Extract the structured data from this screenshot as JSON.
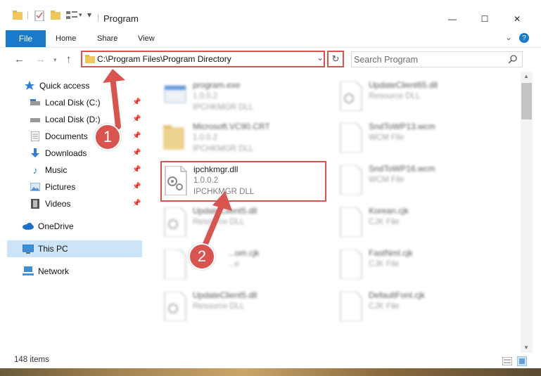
{
  "window": {
    "title": "Program",
    "minimize_label": "—",
    "maximize_label": "☐",
    "close_label": "✕"
  },
  "ribbon": {
    "tabs": [
      {
        "label": "File"
      },
      {
        "label": "Home"
      },
      {
        "label": "Share"
      },
      {
        "label": "View"
      }
    ],
    "help_label": "?"
  },
  "address": {
    "path": "C:\\Program Files\\Program Directory",
    "dropdown_glyph": "⌄",
    "refresh_glyph": "↻"
  },
  "search": {
    "placeholder": "Search Program"
  },
  "sidebar": {
    "items": [
      {
        "label": "Quick access",
        "icon": "star-icon"
      },
      {
        "label": "Local Disk (C:)",
        "icon": "drive-icon",
        "pinned": true
      },
      {
        "label": "Local Disk (D:)",
        "icon": "drive-icon",
        "pinned": true
      },
      {
        "label": "Documents",
        "icon": "documents-icon",
        "pinned": true
      },
      {
        "label": "Downloads",
        "icon": "download-icon",
        "pinned": true
      },
      {
        "label": "Music",
        "icon": "music-icon",
        "pinned": true
      },
      {
        "label": "Pictures",
        "icon": "pictures-icon",
        "pinned": true
      },
      {
        "label": "Videos",
        "icon": "videos-icon",
        "pinned": true
      },
      {
        "label": "OneDrive",
        "icon": "cloud-icon"
      },
      {
        "label": "This PC",
        "icon": "computer-icon",
        "selected": true
      },
      {
        "label": "Network",
        "icon": "network-icon"
      }
    ]
  },
  "files": {
    "left": [
      {
        "name": "program.exe",
        "line2": "1.0.0.2",
        "line3": "IPCHKMGR DLL",
        "icon": "exe-icon"
      },
      {
        "name": "Microsoft.VC90.CRT",
        "line2": "1.0.0.2",
        "line3": "IPCHKMGR DLL",
        "icon": "folder-icon"
      },
      {
        "name": "ipchkmgr.dll",
        "line2": "1.0.0.2",
        "line3": "IPCHKMGR DLL",
        "icon": "dll-icon"
      },
      {
        "name": "UpdateClient5.dll",
        "line2": "Resource DLL",
        "line3": "",
        "icon": "dll-icon"
      },
      {
        "name": "...om.cjk",
        "line2": "...e",
        "line3": "",
        "icon": "file-icon"
      },
      {
        "name": "UpdateClient5.dll",
        "line2": "Resource DLL",
        "line3": "",
        "icon": "dll-icon"
      }
    ],
    "right": [
      {
        "name": "UpdateClient65.dll",
        "line2": "Resource DLL",
        "line3": "",
        "icon": "dll-icon"
      },
      {
        "name": "SndToWP13.wcm",
        "line2": "WCM File",
        "line3": "",
        "icon": "file-icon"
      },
      {
        "name": "SndToWP16.wcm",
        "line2": "WCM File",
        "line3": "",
        "icon": "file-icon"
      },
      {
        "name": "Korean.cjk",
        "line2": "CJK File",
        "line3": "",
        "icon": "file-icon"
      },
      {
        "name": "FastNml.cjk",
        "line2": "CJK File",
        "line3": "",
        "icon": "file-icon"
      },
      {
        "name": "DefaultFont.cjk",
        "line2": "CJK File",
        "line3": "",
        "icon": "file-icon"
      }
    ]
  },
  "status": {
    "item_count": "148 items"
  },
  "callouts": [
    {
      "number": "1"
    },
    {
      "number": "2"
    }
  ],
  "colors": {
    "accent": "#1979ca",
    "callout": "#d9534f",
    "selection": "#cce4f7"
  }
}
